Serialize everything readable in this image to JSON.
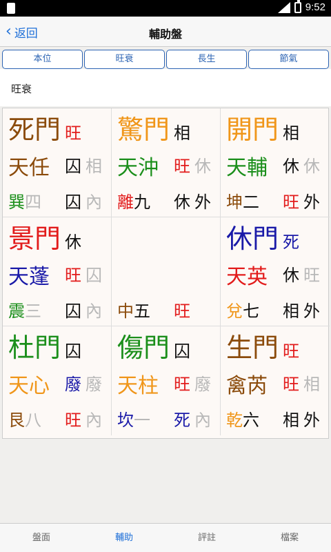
{
  "statusbar": {
    "time": "9:52",
    "network": "LTE"
  },
  "navbar": {
    "back_label": "返回",
    "title": "輔助盤"
  },
  "tabs": [
    {
      "label": "本位"
    },
    {
      "label": "旺衰"
    },
    {
      "label": "長生"
    },
    {
      "label": "節氣"
    }
  ],
  "subhead": "旺衰",
  "grid": [
    {
      "door": "死門",
      "door_color": "#8b4b0b",
      "door_state": "旺",
      "door_state_color": "#e21b1b",
      "star": "天任",
      "star_color": "#8b4b0b",
      "star_s1": "囚",
      "star_s1_color": "#111",
      "star_s2": "相",
      "star_s2_color": "#b8b8b8",
      "gua": "巽",
      "gua_color": "#1b8f1b",
      "num": "四",
      "num_color": "#b8b8b8",
      "g_s1": "囚",
      "g_s1_color": "#111",
      "g_s2": "內",
      "g_s2_color": "#b8b8b8"
    },
    {
      "door": "驚門",
      "door_color": "#f0961a",
      "door_state": "相",
      "door_state_color": "#111",
      "star": "天沖",
      "star_color": "#1b8f1b",
      "star_s1": "旺",
      "star_s1_color": "#e21b1b",
      "star_s2": "休",
      "star_s2_color": "#b8b8b8",
      "gua": "離",
      "gua_color": "#e21b1b",
      "num": "九",
      "num_color": "#111",
      "g_s1": "休",
      "g_s1_color": "#111",
      "g_s2": "外",
      "g_s2_color": "#111"
    },
    {
      "door": "開門",
      "door_color": "#f0961a",
      "door_state": "相",
      "door_state_color": "#111",
      "star": "天輔",
      "star_color": "#1b8f1b",
      "star_s1": "休",
      "star_s1_color": "#111",
      "star_s2": "休",
      "star_s2_color": "#b8b8b8",
      "gua": "坤",
      "gua_color": "#8b4b0b",
      "num": "二",
      "num_color": "#111",
      "g_s1": "旺",
      "g_s1_color": "#e21b1b",
      "g_s2": "外",
      "g_s2_color": "#111"
    },
    {
      "door": "景門",
      "door_color": "#e21b1b",
      "door_state": "休",
      "door_state_color": "#111",
      "star": "天蓬",
      "star_color": "#1a1aa8",
      "star_s1": "旺",
      "star_s1_color": "#e21b1b",
      "star_s2": "囚",
      "star_s2_color": "#b8b8b8",
      "gua": "震",
      "gua_color": "#1b8f1b",
      "num": "三",
      "num_color": "#b8b8b8",
      "g_s1": "囚",
      "g_s1_color": "#111",
      "g_s2": "內",
      "g_s2_color": "#b8b8b8"
    },
    {
      "door": "",
      "door_color": "#111",
      "door_state": "",
      "door_state_color": "#111",
      "star": "",
      "star_color": "#111",
      "star_s1": "",
      "star_s1_color": "#111",
      "star_s2": "",
      "star_s2_color": "#111",
      "gua": "中",
      "gua_color": "#8b4b0b",
      "num": "五",
      "num_color": "#111",
      "g_s1": "旺",
      "g_s1_color": "#e21b1b",
      "g_s2": "",
      "g_s2_color": "#111"
    },
    {
      "door": "休門",
      "door_color": "#1a1aa8",
      "door_state": "死",
      "door_state_color": "#1a1aa8",
      "star": "天英",
      "star_color": "#e21b1b",
      "star_s1": "休",
      "star_s1_color": "#111",
      "star_s2": "旺",
      "star_s2_color": "#b8b8b8",
      "gua": "兌",
      "gua_color": "#f0961a",
      "num": "七",
      "num_color": "#111",
      "g_s1": "相",
      "g_s1_color": "#111",
      "g_s2": "外",
      "g_s2_color": "#111"
    },
    {
      "door": "杜門",
      "door_color": "#1b8f1b",
      "door_state": "囚",
      "door_state_color": "#111",
      "star": "天心",
      "star_color": "#f0961a",
      "star_s1": "廢",
      "star_s1_color": "#1a1aa8",
      "star_s2": "廢",
      "star_s2_color": "#b8b8b8",
      "gua": "艮",
      "gua_color": "#8b4b0b",
      "num": "八",
      "num_color": "#b8b8b8",
      "g_s1": "旺",
      "g_s1_color": "#e21b1b",
      "g_s2": "內",
      "g_s2_color": "#b8b8b8"
    },
    {
      "door": "傷門",
      "door_color": "#1b8f1b",
      "door_state": "囚",
      "door_state_color": "#111",
      "star": "天柱",
      "star_color": "#f0961a",
      "star_s1": "旺",
      "star_s1_color": "#e21b1b",
      "star_s2": "廢",
      "star_s2_color": "#b8b8b8",
      "gua": "坎",
      "gua_color": "#1a1aa8",
      "num": "一",
      "num_color": "#b8b8b8",
      "g_s1": "死",
      "g_s1_color": "#1a1aa8",
      "g_s2": "內",
      "g_s2_color": "#b8b8b8"
    },
    {
      "door": "生門",
      "door_color": "#8b4b0b",
      "door_state": "旺",
      "door_state_color": "#e21b1b",
      "star": "禽芮",
      "star_color": "#8b4b0b",
      "star_s1": "旺",
      "star_s1_color": "#e21b1b",
      "star_s2": "相",
      "star_s2_color": "#b8b8b8",
      "gua": "乾",
      "gua_color": "#f0961a",
      "num": "六",
      "num_color": "#111",
      "g_s1": "相",
      "g_s1_color": "#111",
      "g_s2": "外",
      "g_s2_color": "#111"
    }
  ],
  "tabbar": [
    {
      "label": "盤面"
    },
    {
      "label": "輔助"
    },
    {
      "label": "評註"
    },
    {
      "label": "檔案"
    }
  ]
}
